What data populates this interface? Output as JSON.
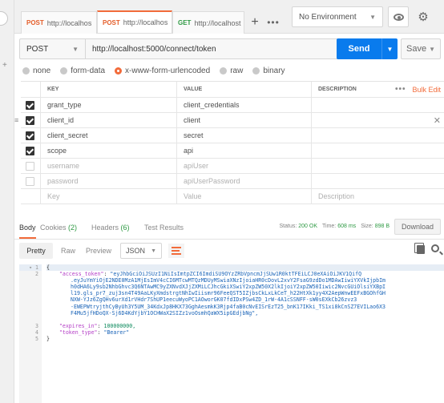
{
  "tabs": [
    {
      "method": "POST",
      "label": "http://localhos",
      "modified": true
    },
    {
      "method": "POST",
      "label": "http://localhos",
      "modified": true
    },
    {
      "method": "GET",
      "label": "http://localhost",
      "modified": true
    }
  ],
  "tab_more": "•••",
  "environment": {
    "selected": "No Environment"
  },
  "request": {
    "method": "POST",
    "url": "http://localhost:5000/connect/token",
    "send_label": "Send",
    "save_label": "Save"
  },
  "body_types": [
    "none",
    "form-data",
    "x-www-form-urlencoded",
    "raw",
    "binary"
  ],
  "selected_body_type": "x-www-form-urlencoded",
  "params_table": {
    "headers": {
      "key": "KEY",
      "value": "VALUE",
      "description": "DESCRIPTION",
      "bulk_edit": "Bulk Edit",
      "more": "•••"
    },
    "rows": [
      {
        "checked": true,
        "key": "grant_type",
        "value": "client_credentials",
        "description": ""
      },
      {
        "checked": true,
        "key": "client_id",
        "value": "client",
        "description": ""
      },
      {
        "checked": true,
        "key": "client_secret",
        "value": "secret",
        "description": ""
      },
      {
        "checked": true,
        "key": "scope",
        "value": "api",
        "description": ""
      },
      {
        "checked": false,
        "key": "username",
        "value": "apiUser",
        "description": ""
      },
      {
        "checked": false,
        "key": "password",
        "value": "apiUserPassword",
        "description": ""
      }
    ],
    "placeholder": {
      "key": "Key",
      "value": "Value",
      "description": "Description"
    }
  },
  "response_tabs": {
    "body": "Body",
    "cookies": "Cookies",
    "cookies_count": "(2)",
    "headers": "Headers",
    "headers_count": "(6)",
    "tests": "Test Results"
  },
  "response_meta": {
    "status_label": "Status:",
    "status": "200 OK",
    "time_label": "Time:",
    "time": "608 ms",
    "size_label": "Size:",
    "size": "898 B"
  },
  "download_label": "Download",
  "view_tabs": {
    "pretty": "Pretty",
    "raw": "Raw",
    "preview": "Preview"
  },
  "format": "JSON",
  "code": {
    "line_numbers": [
      "1",
      "2",
      "",
      "",
      "",
      "",
      "",
      "",
      "",
      "3",
      "4",
      "5"
    ],
    "open": "{",
    "access_token_key": "\"access_token\"",
    "access_token_lines": [
      "\"eyJhbGciOiJSUzI1NiIsImtpZCI6ImdiSU9OYzZRbVpncmJjSUw1R0ktTFEiLCJ0eXAiOiJKV1QifQ",
      ".eyJuYmYiOjE2NDE0MzA1MjEsImV4cCI6MTcwMTQzMDUyMSwiaXNzIjoiaHR0cDovL2xvY2FsaG9zdDo1MDAwIiwiYXVkIjpbIm",
      "h0dHA6Ly9sb2NhbGhvc3Q6NTAwMC9yZXNvdXJjZXMiLCJhcGkiXSwiY2xpZW50X2lkIjoiY2xpZW50Iiwic2NvcGUiOlsiYXBpI",
      "l19.gls_pr7_zuj3sn4T49AaLKyXmdstrgtNhIwIiismr96FeeQST5IZjbsCkLxLkCeT_h22HtXk1yy4X2AepWnwEEFxBGOhfGH",
      "NXW-YJz6ZgQHv6urXd1rVHdr7ShUP1eecuWyoPC1AOworGK07fdIDxPSw4ZD_1rW-4A1cSSNFF-sW0sEXkCb26zvz3",
      "-EWEPWtryjthCyByUh3Y5UM_34KdxJp8HKX73GghAesmkK3Rjp4faB0cNvEISrEzT25_bnK17IKki_TS1xi8kCnSZ7EVILao6X3",
      "F4Mu5jfHDoQX-Sj6D4KdYjbY1OCHWaX2SIZz1voOsmhQaWX5ipGEdjbNg\","
    ],
    "expires_key": "\"expires_in\"",
    "expires_value": "100000000,",
    "token_type_key": "\"token_type\"",
    "token_type_value": "\"Bearer\"",
    "close": "}"
  }
}
